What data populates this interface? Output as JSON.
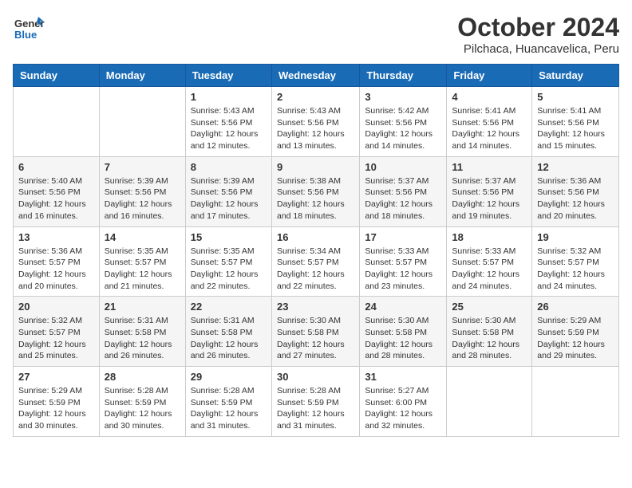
{
  "header": {
    "logo_general": "General",
    "logo_blue": "Blue",
    "month_year": "October 2024",
    "location": "Pilchaca, Huancavelica, Peru"
  },
  "weekdays": [
    "Sunday",
    "Monday",
    "Tuesday",
    "Wednesday",
    "Thursday",
    "Friday",
    "Saturday"
  ],
  "weeks": [
    [
      {
        "day": "",
        "info": ""
      },
      {
        "day": "",
        "info": ""
      },
      {
        "day": "1",
        "info": "Sunrise: 5:43 AM\nSunset: 5:56 PM\nDaylight: 12 hours\nand 12 minutes."
      },
      {
        "day": "2",
        "info": "Sunrise: 5:43 AM\nSunset: 5:56 PM\nDaylight: 12 hours\nand 13 minutes."
      },
      {
        "day": "3",
        "info": "Sunrise: 5:42 AM\nSunset: 5:56 PM\nDaylight: 12 hours\nand 14 minutes."
      },
      {
        "day": "4",
        "info": "Sunrise: 5:41 AM\nSunset: 5:56 PM\nDaylight: 12 hours\nand 14 minutes."
      },
      {
        "day": "5",
        "info": "Sunrise: 5:41 AM\nSunset: 5:56 PM\nDaylight: 12 hours\nand 15 minutes."
      }
    ],
    [
      {
        "day": "6",
        "info": "Sunrise: 5:40 AM\nSunset: 5:56 PM\nDaylight: 12 hours\nand 16 minutes."
      },
      {
        "day": "7",
        "info": "Sunrise: 5:39 AM\nSunset: 5:56 PM\nDaylight: 12 hours\nand 16 minutes."
      },
      {
        "day": "8",
        "info": "Sunrise: 5:39 AM\nSunset: 5:56 PM\nDaylight: 12 hours\nand 17 minutes."
      },
      {
        "day": "9",
        "info": "Sunrise: 5:38 AM\nSunset: 5:56 PM\nDaylight: 12 hours\nand 18 minutes."
      },
      {
        "day": "10",
        "info": "Sunrise: 5:37 AM\nSunset: 5:56 PM\nDaylight: 12 hours\nand 18 minutes."
      },
      {
        "day": "11",
        "info": "Sunrise: 5:37 AM\nSunset: 5:56 PM\nDaylight: 12 hours\nand 19 minutes."
      },
      {
        "day": "12",
        "info": "Sunrise: 5:36 AM\nSunset: 5:56 PM\nDaylight: 12 hours\nand 20 minutes."
      }
    ],
    [
      {
        "day": "13",
        "info": "Sunrise: 5:36 AM\nSunset: 5:57 PM\nDaylight: 12 hours\nand 20 minutes."
      },
      {
        "day": "14",
        "info": "Sunrise: 5:35 AM\nSunset: 5:57 PM\nDaylight: 12 hours\nand 21 minutes."
      },
      {
        "day": "15",
        "info": "Sunrise: 5:35 AM\nSunset: 5:57 PM\nDaylight: 12 hours\nand 22 minutes."
      },
      {
        "day": "16",
        "info": "Sunrise: 5:34 AM\nSunset: 5:57 PM\nDaylight: 12 hours\nand 22 minutes."
      },
      {
        "day": "17",
        "info": "Sunrise: 5:33 AM\nSunset: 5:57 PM\nDaylight: 12 hours\nand 23 minutes."
      },
      {
        "day": "18",
        "info": "Sunrise: 5:33 AM\nSunset: 5:57 PM\nDaylight: 12 hours\nand 24 minutes."
      },
      {
        "day": "19",
        "info": "Sunrise: 5:32 AM\nSunset: 5:57 PM\nDaylight: 12 hours\nand 24 minutes."
      }
    ],
    [
      {
        "day": "20",
        "info": "Sunrise: 5:32 AM\nSunset: 5:57 PM\nDaylight: 12 hours\nand 25 minutes."
      },
      {
        "day": "21",
        "info": "Sunrise: 5:31 AM\nSunset: 5:58 PM\nDaylight: 12 hours\nand 26 minutes."
      },
      {
        "day": "22",
        "info": "Sunrise: 5:31 AM\nSunset: 5:58 PM\nDaylight: 12 hours\nand 26 minutes."
      },
      {
        "day": "23",
        "info": "Sunrise: 5:30 AM\nSunset: 5:58 PM\nDaylight: 12 hours\nand 27 minutes."
      },
      {
        "day": "24",
        "info": "Sunrise: 5:30 AM\nSunset: 5:58 PM\nDaylight: 12 hours\nand 28 minutes."
      },
      {
        "day": "25",
        "info": "Sunrise: 5:30 AM\nSunset: 5:58 PM\nDaylight: 12 hours\nand 28 minutes."
      },
      {
        "day": "26",
        "info": "Sunrise: 5:29 AM\nSunset: 5:59 PM\nDaylight: 12 hours\nand 29 minutes."
      }
    ],
    [
      {
        "day": "27",
        "info": "Sunrise: 5:29 AM\nSunset: 5:59 PM\nDaylight: 12 hours\nand 30 minutes."
      },
      {
        "day": "28",
        "info": "Sunrise: 5:28 AM\nSunset: 5:59 PM\nDaylight: 12 hours\nand 30 minutes."
      },
      {
        "day": "29",
        "info": "Sunrise: 5:28 AM\nSunset: 5:59 PM\nDaylight: 12 hours\nand 31 minutes."
      },
      {
        "day": "30",
        "info": "Sunrise: 5:28 AM\nSunset: 5:59 PM\nDaylight: 12 hours\nand 31 minutes."
      },
      {
        "day": "31",
        "info": "Sunrise: 5:27 AM\nSunset: 6:00 PM\nDaylight: 12 hours\nand 32 minutes."
      },
      {
        "day": "",
        "info": ""
      },
      {
        "day": "",
        "info": ""
      }
    ]
  ]
}
